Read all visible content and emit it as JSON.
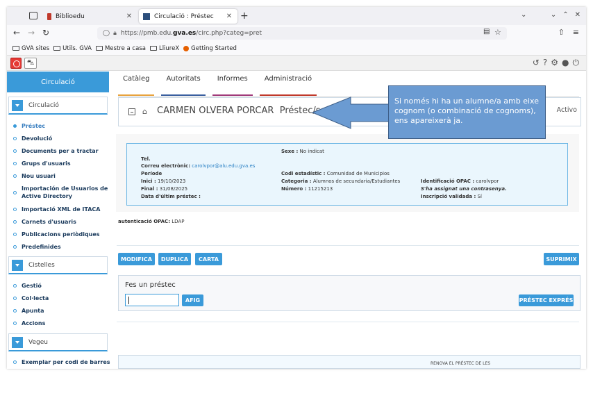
{
  "browser": {
    "tabs": [
      {
        "label": "Biblioedu",
        "active": false
      },
      {
        "label": "Circulació : Préstec",
        "active": true
      }
    ],
    "url": {
      "prefix": "https://pmb.edu.",
      "domain": "gva.es",
      "path": "/circ.php?categ=pret"
    },
    "bookmarks": [
      "GVA sites",
      "Utils. GVA",
      "Mestre a casa",
      "LliureX",
      "Getting Started"
    ]
  },
  "app": {
    "module_title": "Circulació",
    "main_tabs": [
      {
        "label": "Catàleg",
        "color": "#e8a33d"
      },
      {
        "label": "Autoritats",
        "color": "#3a5f9f"
      },
      {
        "label": "Informes",
        "color": "#a03a7a"
      },
      {
        "label": "Administració",
        "color": "#c0392b"
      }
    ],
    "sidebar": {
      "sections": [
        {
          "title": "Circulació"
        },
        {
          "title": "Cistelles"
        },
        {
          "title": "Vegeu"
        }
      ],
      "circ_items": [
        "Préstec",
        "Devolució",
        "Documents per a tractar",
        "Grups d'usuaris",
        "Nou usuari",
        "Importación de Usuarios de",
        "Active Directory",
        "Importació XML de ITACA",
        "Carnets d'usuaris",
        "Publicacions periòdiques",
        "Predefinides"
      ],
      "cart_items": [
        "Gestió",
        "Col·lecta",
        "Apunta",
        "Accions"
      ],
      "view_items": [
        "Exemplar per codi de barres"
      ]
    },
    "user": {
      "name": "CARMEN OLVERA PORCAR",
      "context": "Préstec/s",
      "status": "Activo"
    },
    "info": {
      "sexe_label": "Sexe :",
      "sexe_value": "No indicat",
      "tel_label": "Tel.",
      "email_label": "Correu electrònic:",
      "email_value": "carolvpor@alu.edu.gva.es",
      "period_label": "Període",
      "codi_label": "Codi estadístic :",
      "codi_value": "Comunidad de Municipios",
      "inici_label": "Inici :",
      "inici_value": "19/10/2023",
      "categoria_label": "Categoria :",
      "categoria_value": "Alumnos de secundaria/Estudiantes",
      "opac_id_label": "Identificació OPAC :",
      "opac_id_value": "carolvpor",
      "final_label": "Final :",
      "final_value": "31/08/2025",
      "numero_label": "Número :",
      "numero_value": "11215213",
      "password_note": "S'ha assignat una contrasenya.",
      "last_loan_label": "Data d'últim préstec :",
      "inscripcio_label": "Inscripció validada :",
      "inscripcio_value": "Sí",
      "auth_label": "autenticació OPAC:",
      "auth_value": "LDAP"
    },
    "actions": {
      "modify": "MODIFICA",
      "duplicate": "DUPLICA",
      "letter": "CARTA",
      "delete": "SUPRIMIX"
    },
    "loan": {
      "title": "Fes un préstec",
      "input_value": "",
      "add": "AFIG",
      "express": "PRÉSTEC EXPRÉS"
    },
    "renew": "RENOVA EL PRÉSTEC DE LES"
  },
  "callout": {
    "text": "Si només hi ha un alumne/a amb eixe cognom (o combinació de cognoms), ens apareixerà ja.",
    "fill": "#6b9bd2",
    "border": "#3e5f88"
  }
}
